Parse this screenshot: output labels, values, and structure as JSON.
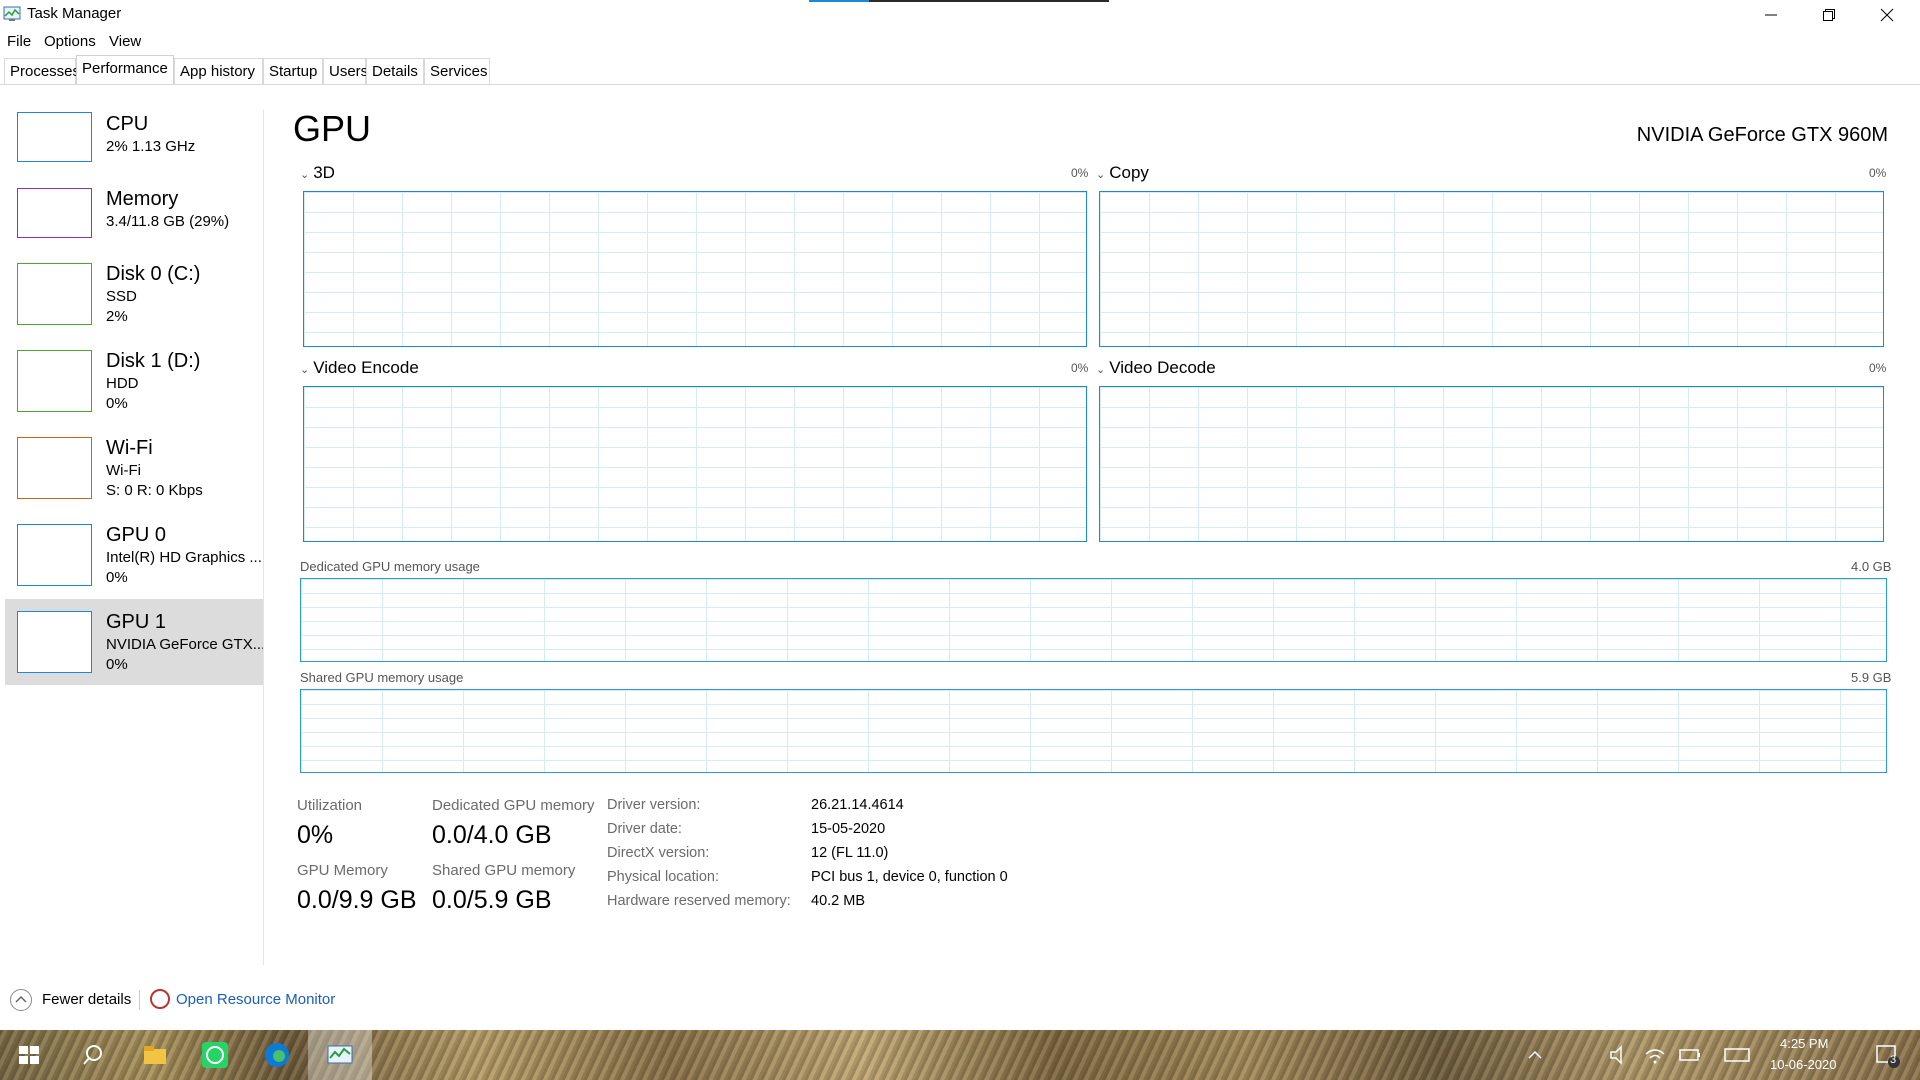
{
  "window": {
    "title": "Task Manager"
  },
  "menu": [
    "File",
    "Options",
    "View"
  ],
  "tabs": [
    "Processes",
    "Performance",
    "App history",
    "Startup",
    "Users",
    "Details",
    "Services"
  ],
  "active_tab": "Performance",
  "sidebar": {
    "items": [
      {
        "name": "CPU",
        "line1": "2%  1.13 GHz",
        "line2": "",
        "color": "#1a8ad4"
      },
      {
        "name": "Memory",
        "line1": "3.4/11.8 GB (29%)",
        "line2": "",
        "color": "#8b2fc9"
      },
      {
        "name": "Disk 0 (C:)",
        "line1": "SSD",
        "line2": "2%",
        "color": "#4ca82b"
      },
      {
        "name": "Disk 1 (D:)",
        "line1": "HDD",
        "line2": "0%",
        "color": "#4ca82b"
      },
      {
        "name": "Wi-Fi",
        "line1": "Wi-Fi",
        "line2": "S: 0  R: 0 Kbps",
        "color": "#c9641a"
      },
      {
        "name": "GPU 0",
        "line1": "Intel(R) HD Graphics ...",
        "line2": "0%",
        "color": "#1a8ad4"
      },
      {
        "name": "GPU 1",
        "line1": "NVIDIA GeForce GTX...",
        "line2": "0%",
        "color": "#1a8ad4"
      }
    ],
    "selected": "GPU 1"
  },
  "main": {
    "title": "GPU",
    "model": "NVIDIA GeForce GTX 960M",
    "engines": [
      {
        "label": "3D",
        "pct": "0%"
      },
      {
        "label": "Copy",
        "pct": "0%"
      },
      {
        "label": "Video Encode",
        "pct": "0%"
      },
      {
        "label": "Video Decode",
        "pct": "0%"
      }
    ],
    "dedicated_label": "Dedicated GPU memory usage",
    "dedicated_max": "4.0 GB",
    "shared_label": "Shared GPU memory usage",
    "shared_max": "5.9 GB"
  },
  "stats": {
    "utilization_label": "Utilization",
    "utilization_value": "0%",
    "dedicated_label": "Dedicated GPU memory",
    "dedicated_value": "0.0/4.0 GB",
    "gpu_memory_label": "GPU Memory",
    "gpu_memory_value": "0.0/9.9 GB",
    "shared_label": "Shared GPU memory",
    "shared_value": "0.0/5.9 GB"
  },
  "info": [
    {
      "label": "Driver version:",
      "value": "26.21.14.4614"
    },
    {
      "label": "Driver date:",
      "value": "15-05-2020"
    },
    {
      "label": "DirectX version:",
      "value": "12 (FL 11.0)"
    },
    {
      "label": "Physical location:",
      "value": "PCI bus 1, device 0, function 0"
    },
    {
      "label": "Hardware reserved memory:",
      "value": "40.2 MB"
    }
  ],
  "footer": {
    "fewer_details": "Fewer details",
    "resource_monitor": "Open Resource Monitor"
  },
  "taskbar": {
    "time": "4:25 PM",
    "date": "10-06-2020",
    "notification_count": "3"
  },
  "accent_color": "#1a8ad4"
}
